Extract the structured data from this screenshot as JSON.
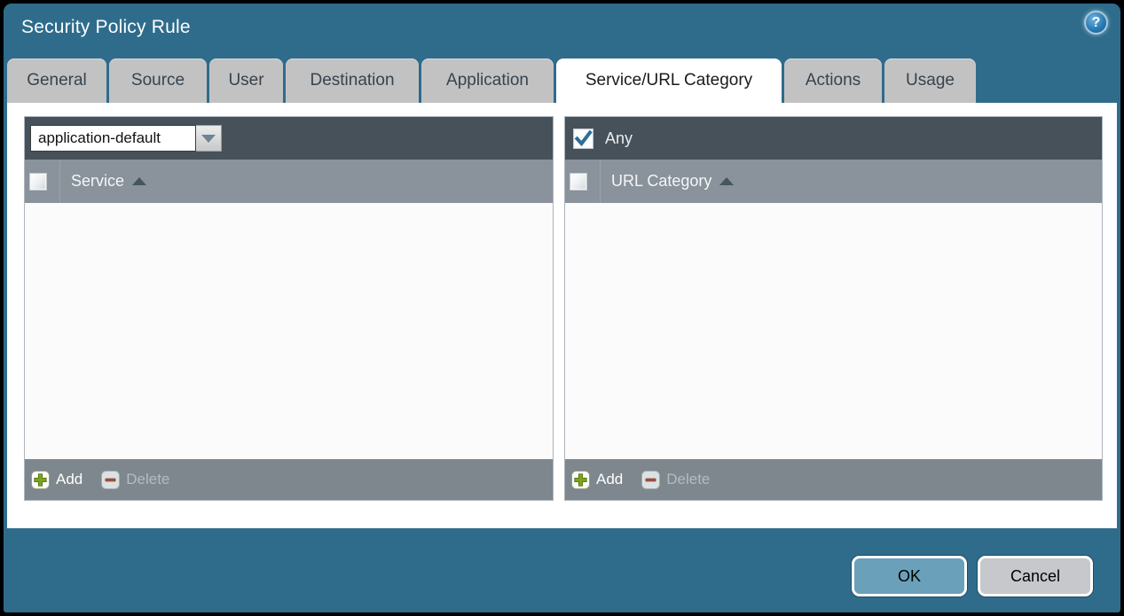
{
  "window": {
    "title": "Security Policy Rule"
  },
  "icons": {
    "help": "?",
    "sort_ascending": "up-triangle",
    "dropdown": "down-triangle",
    "add": "plus",
    "delete": "minus",
    "any_checkbox": "check"
  },
  "tabs": [
    {
      "label": "General"
    },
    {
      "label": "Source"
    },
    {
      "label": "User"
    },
    {
      "label": "Destination"
    },
    {
      "label": "Application"
    },
    {
      "label": "Service/URL Category"
    },
    {
      "label": "Actions"
    },
    {
      "label": "Usage"
    }
  ],
  "active_tab": "Service/URL Category",
  "service_panel": {
    "service_type_value": "application-default",
    "column_header": "Service",
    "select_all_checked": false,
    "sort": "ascending",
    "rows": [],
    "footer": {
      "add": "Add",
      "delete": "Delete",
      "delete_enabled": false
    }
  },
  "url_category_panel": {
    "any_label": "Any",
    "any_checked": true,
    "column_header": "URL Category",
    "select_all_checked": false,
    "sort": "ascending",
    "rows": [],
    "footer": {
      "add": "Add",
      "delete": "Delete",
      "delete_enabled": false
    }
  },
  "actions": {
    "ok": "OK",
    "cancel": "Cancel"
  },
  "colors": {
    "dialog_teal": "#2f6c8c",
    "panel_header_dark": "#47515a",
    "column_header_gray": "#8a929b",
    "footer_gray": "#7e878e",
    "tab_gray": "#c2c2c3",
    "active_tab_white": "#ffffff",
    "ok_button_blue": "#6ba0bb",
    "cancel_button_gray": "#c7c8cc",
    "add_plus_green": "#7fa41c",
    "delete_minus_red": "#9a4636",
    "checkmark_teal": "#2d6e94"
  }
}
